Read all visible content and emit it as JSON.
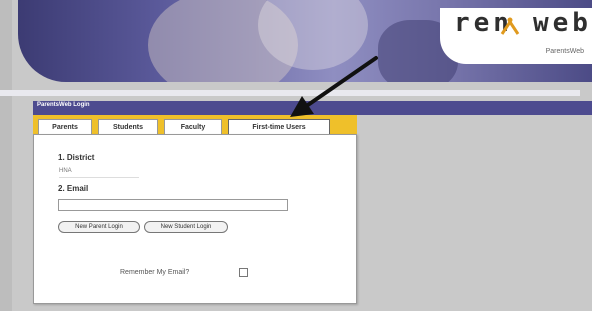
{
  "logo": {
    "name": "ren web",
    "letters_left": "ren",
    "letters_right": "web",
    "subtitle": "ParentsWeb"
  },
  "header": {
    "title": "ParentsWeb Login"
  },
  "tabs": [
    {
      "label": "Parents",
      "active": false
    },
    {
      "label": "Students",
      "active": false
    },
    {
      "label": "Faculty",
      "active": false
    },
    {
      "label": "First-time Users",
      "active": true
    }
  ],
  "form": {
    "district_label": "1. District",
    "district_value": "HNA",
    "email_label": "2. Email",
    "email_value": "",
    "new_parent_button": "New Parent Login",
    "new_student_button": "New Student Login",
    "remember_label": "Remember My Email?"
  },
  "colors": {
    "tab_bar": "#efc02a",
    "header_bar": "#4d4b8f",
    "arrow": "#111111"
  },
  "icons": {
    "logo_mark": "person-figure-icon",
    "annotation": "arrow-icon"
  }
}
